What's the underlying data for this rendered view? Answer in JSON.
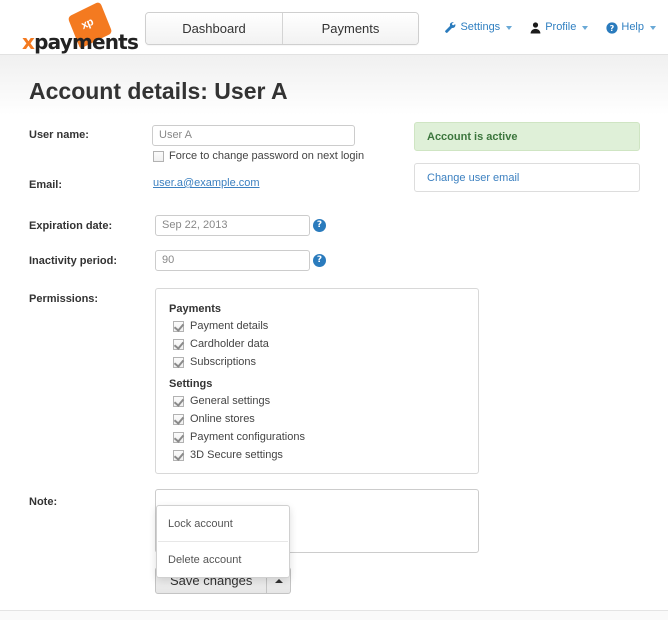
{
  "header": {
    "logo": {
      "word_x": "x",
      "word_rest": "payments",
      "tag_text": "xp",
      "brand_color": "#f47a20"
    },
    "nav": [
      {
        "label": "Dashboard",
        "icon": "none"
      },
      {
        "label": "Payments",
        "icon": "none"
      }
    ],
    "menu": [
      {
        "label": "Settings",
        "icon": "wrench-icon"
      },
      {
        "label": "Profile",
        "icon": "user-icon"
      },
      {
        "label": "Help",
        "icon": "question-circle-icon"
      }
    ],
    "link_color": "#2f7fc1"
  },
  "page": {
    "title": "Account details: User A"
  },
  "form": {
    "username": {
      "label": "User name:",
      "value": "User A"
    },
    "force_change": {
      "label": "Force to change password on next login",
      "checked": false
    },
    "email": {
      "label": "Email:",
      "value": "user.a@example.com"
    },
    "expiration": {
      "label": "Expiration date:",
      "value": "Sep 22, 2013",
      "help": "?"
    },
    "inactivity": {
      "label": "Inactivity period:",
      "value": "90",
      "help": "?"
    },
    "permissions_label": "Permissions:",
    "note_label": "Note:",
    "note_value": ""
  },
  "permissions": [
    {
      "group": "Payments",
      "items": [
        {
          "label": "Payment details",
          "checked": true
        },
        {
          "label": "Cardholder data",
          "checked": true
        },
        {
          "label": "Subscriptions",
          "checked": true
        }
      ]
    },
    {
      "group": "Settings",
      "items": [
        {
          "label": "General settings",
          "checked": true
        },
        {
          "label": "Online stores",
          "checked": true
        },
        {
          "label": "Payment configurations",
          "checked": true
        },
        {
          "label": "3D Secure settings",
          "checked": true
        }
      ]
    }
  ],
  "actions": {
    "save_label": "Save changes",
    "caret_icon": "caret-up-icon",
    "menu_items": [
      {
        "label": "Lock account"
      },
      {
        "label": "Delete account"
      }
    ]
  },
  "sidebar": {
    "status": {
      "text": "Account is active",
      "bg": "#dff0d8",
      "color": "#3c763d"
    },
    "change_email": {
      "label": "Change user email",
      "color": "#3c80c0"
    }
  }
}
